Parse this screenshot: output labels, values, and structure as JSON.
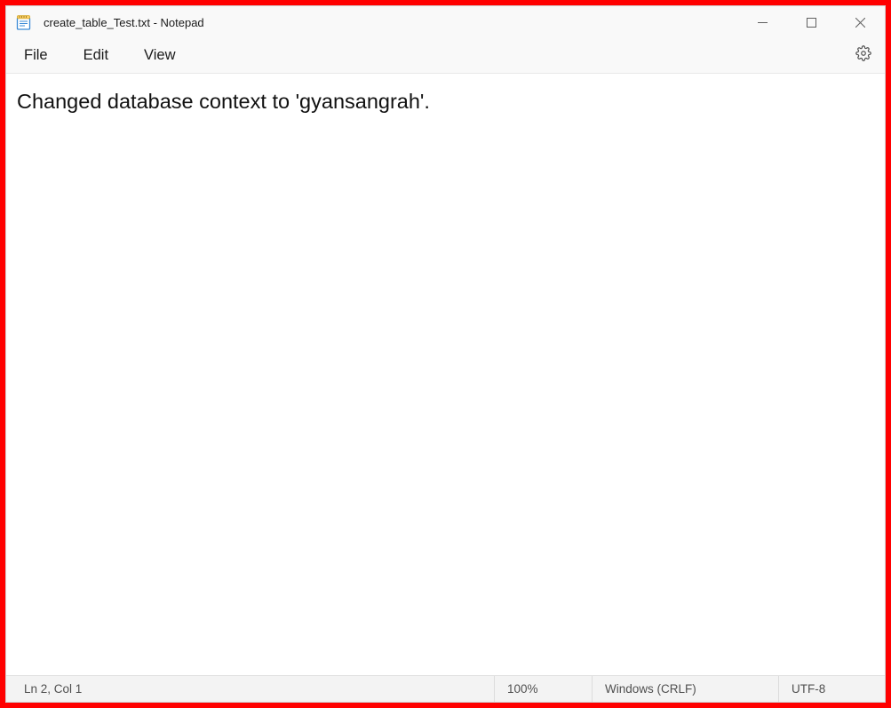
{
  "titlebar": {
    "title": "create_table_Test.txt - Notepad"
  },
  "menu": {
    "file": "File",
    "edit": "Edit",
    "view": "View"
  },
  "editor": {
    "content": "Changed database context to 'gyansangrah'."
  },
  "statusbar": {
    "position": "Ln 2, Col 1",
    "zoom": "100%",
    "eol": "Windows (CRLF)",
    "encoding": "UTF-8"
  }
}
